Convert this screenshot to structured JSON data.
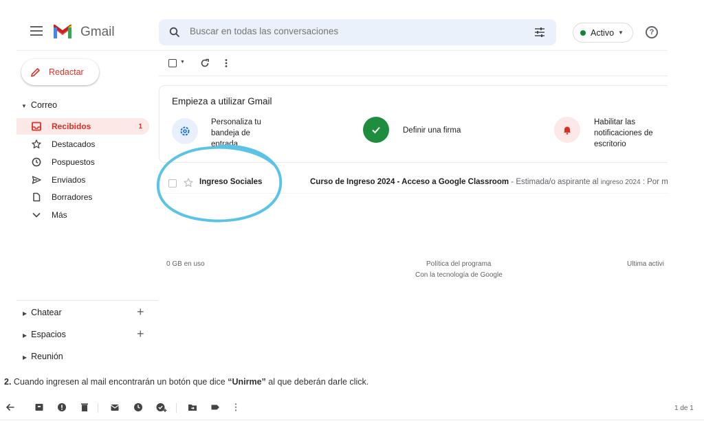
{
  "app": {
    "title": "Gmail"
  },
  "search": {
    "placeholder": "Buscar en todas las conversaciones"
  },
  "status": {
    "label": "Activo"
  },
  "compose": {
    "label": "Redactar"
  },
  "sidebar": {
    "section_mail": "Correo",
    "items": [
      {
        "label": "Recibidos",
        "count": "1",
        "icon": "inbox-icon",
        "active": true
      },
      {
        "label": "Destacados",
        "icon": "star-icon"
      },
      {
        "label": "Pospuestos",
        "icon": "clock-icon"
      },
      {
        "label": "Enviados",
        "icon": "send-icon"
      },
      {
        "label": "Borradores",
        "icon": "draft-icon"
      },
      {
        "label": "Más",
        "icon": "chevron-down-icon"
      }
    ],
    "section_chat": "Chatear",
    "section_spaces": "Espacios",
    "section_meet": "Reunión"
  },
  "getting_started": {
    "title": "Empieza a utilizar Gmail",
    "steps": [
      {
        "line1": "Personaliza tu",
        "line2": "bandeja de",
        "line3": "entrada",
        "icon": "gear-icon"
      },
      {
        "line1": "Definir una firma",
        "icon": "check-icon"
      },
      {
        "line1": "Habilitar las",
        "line2": "notificaciones de",
        "line3": "escritorio",
        "icon": "bell-icon"
      }
    ]
  },
  "email": {
    "sender": "Ingreso Sociales",
    "subject": "Curso de Ingreso 2024 - Acceso a Google Classroom",
    "snippet": " - Estimada/o aspirante al ",
    "snippet_small": "ingreso 2024",
    "snippet_tail": " : Por me"
  },
  "footer": {
    "storage": "0 GB en uso",
    "policy": "Política del programa",
    "powered": "Con la tecnología de Google",
    "last_activity": "Última activi"
  },
  "caption": {
    "number": "2.",
    "text_before": " Cuando ingresen al mail encontrarán un botón que dice ",
    "highlight": "“Unirme”",
    "text_after": " al que deberán darle click."
  },
  "pager": {
    "label": "1 de 1"
  },
  "colors": {
    "accent": "#d93025",
    "annotation": "#5bc4e6",
    "search_bg": "#eaf1fb"
  }
}
